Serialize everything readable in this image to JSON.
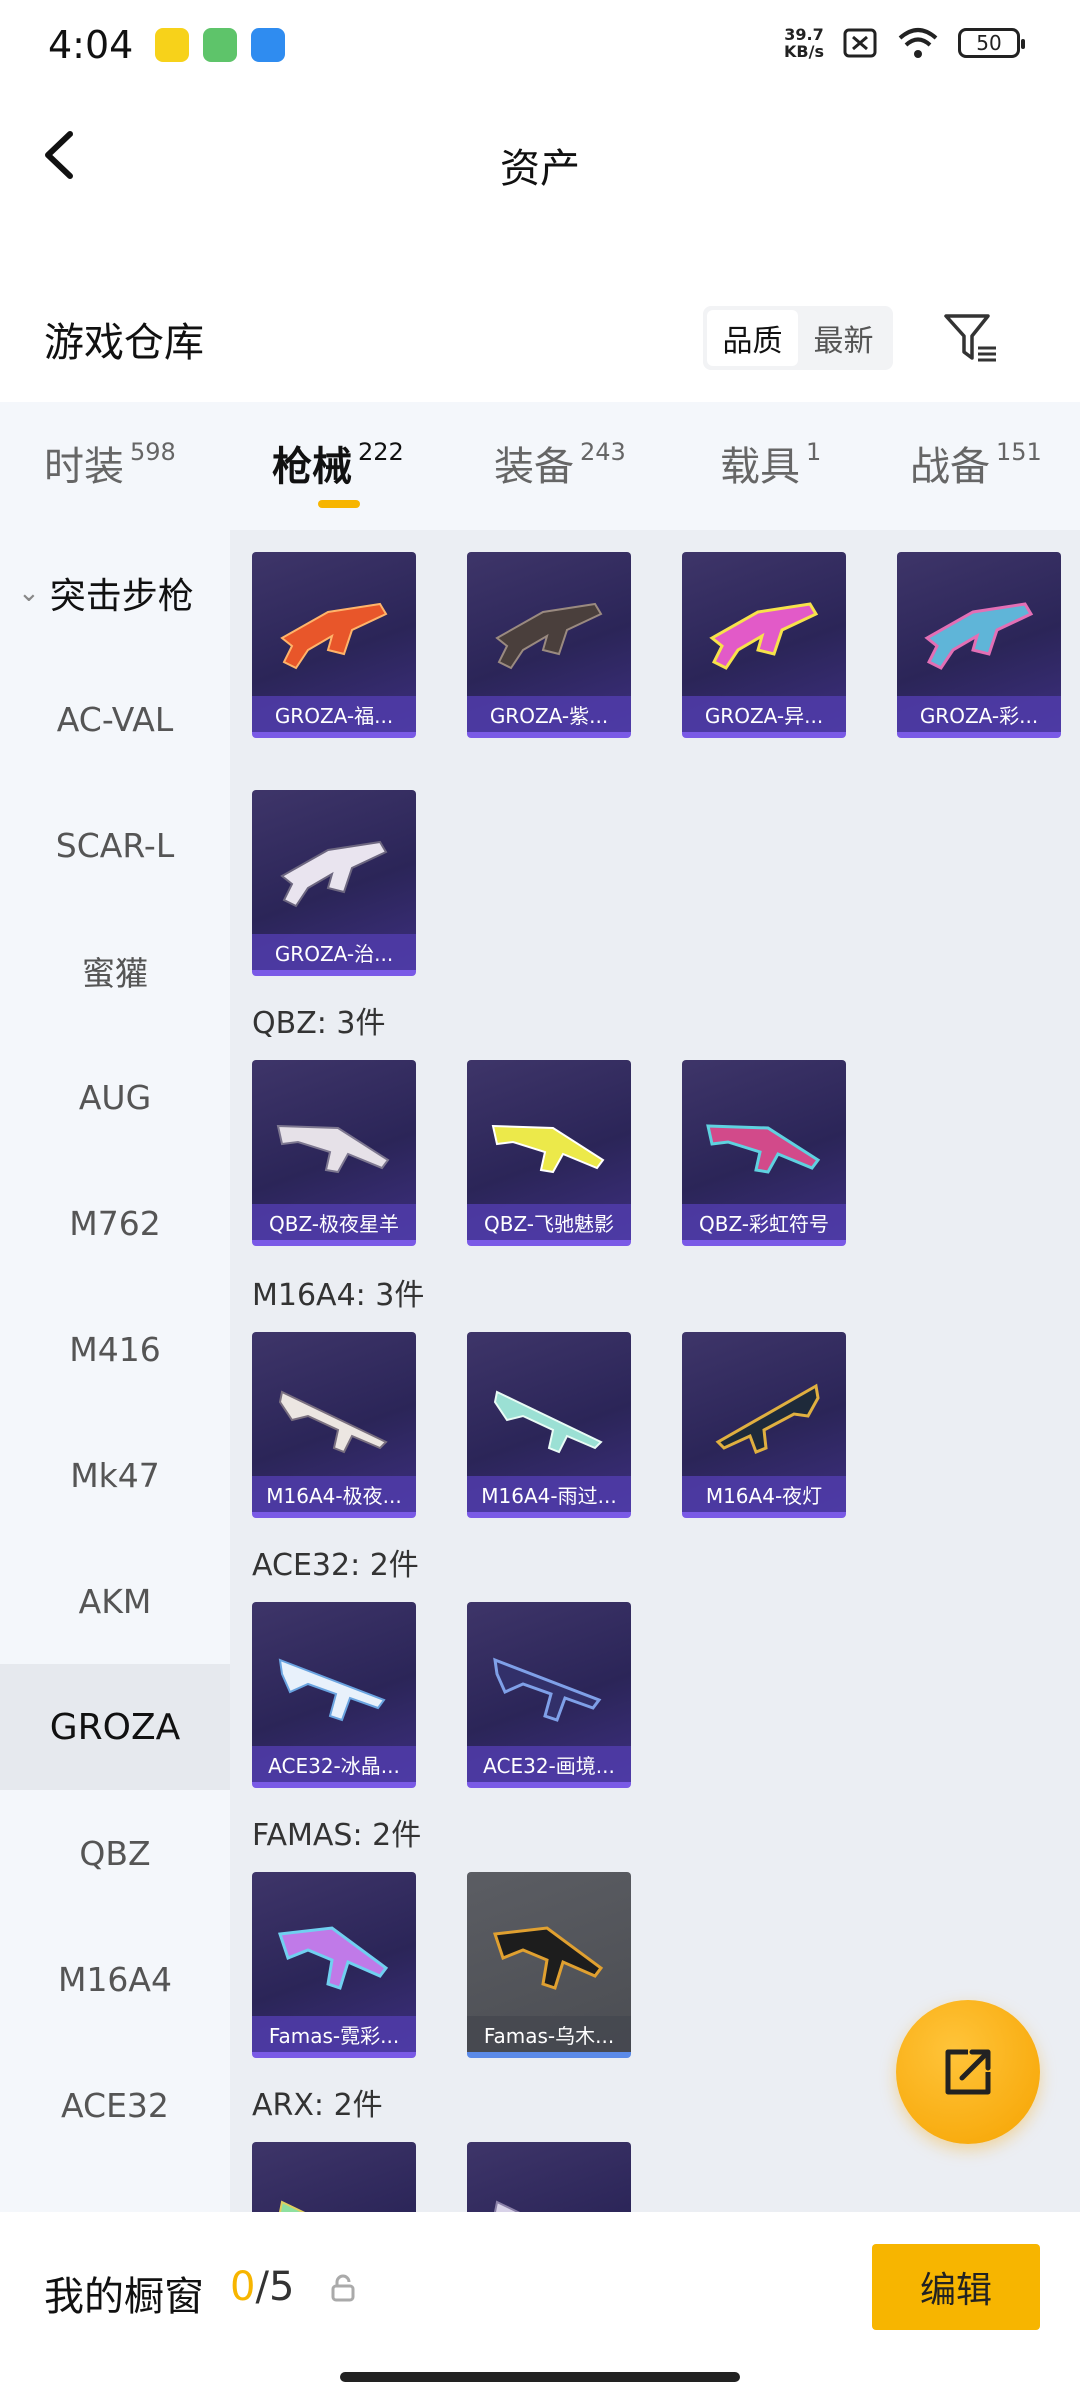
{
  "status": {
    "time": "4:04",
    "net_speed_value": "39.7",
    "net_speed_unit": "KB/s",
    "battery": "50"
  },
  "header": {
    "title": "资产"
  },
  "warehouse": {
    "title": "游戏仓库",
    "sort_options": [
      "品质",
      "最新"
    ],
    "active_sort": "品质"
  },
  "category_tabs": [
    {
      "name": "时装",
      "count": "598"
    },
    {
      "name": "枪械",
      "count": "222"
    },
    {
      "name": "装备",
      "count": "243"
    },
    {
      "name": "载具",
      "count": "1"
    },
    {
      "name": "战备",
      "count": "151"
    }
  ],
  "sidebar": {
    "group": "突击步枪",
    "items": [
      "AC-VAL",
      "SCAR-L",
      "蜜獾",
      "AUG",
      "M762",
      "M416",
      "Mk47",
      "AKM",
      "GROZA",
      "QBZ",
      "M16A4",
      "ACE32"
    ],
    "active": "GROZA"
  },
  "sections": [
    {
      "label": "",
      "items": [
        "GROZA-福...",
        "GROZA-紫...",
        "GROZA-异...",
        "GROZA-彩...",
        "GROZA-治..."
      ]
    },
    {
      "label": "QBZ: 3件",
      "items": [
        "QBZ-极夜星羊",
        "QBZ-飞驰魅影",
        "QBZ-彩虹符号"
      ]
    },
    {
      "label": "M16A4: 3件",
      "items": [
        "M16A4-极夜...",
        "M16A4-雨过...",
        "M16A4-夜灯"
      ]
    },
    {
      "label": "ACE32: 2件",
      "items": [
        "ACE32-冰晶...",
        "ACE32-画境..."
      ]
    },
    {
      "label": "FAMAS: 2件",
      "items": [
        "Famas-霓彩...",
        "Famas-乌木..."
      ]
    },
    {
      "label": "ARX: 2件",
      "items": [
        "",
        ""
      ]
    }
  ],
  "bottom": {
    "showcase_label": "我的橱窗",
    "showcase_current": "0",
    "showcase_sep": "/",
    "showcase_max": "5",
    "edit_label": "编辑"
  },
  "colors": {
    "accent": "#f7b500",
    "card_bg": "#2b2558",
    "card_border": "#7a5ae6"
  }
}
